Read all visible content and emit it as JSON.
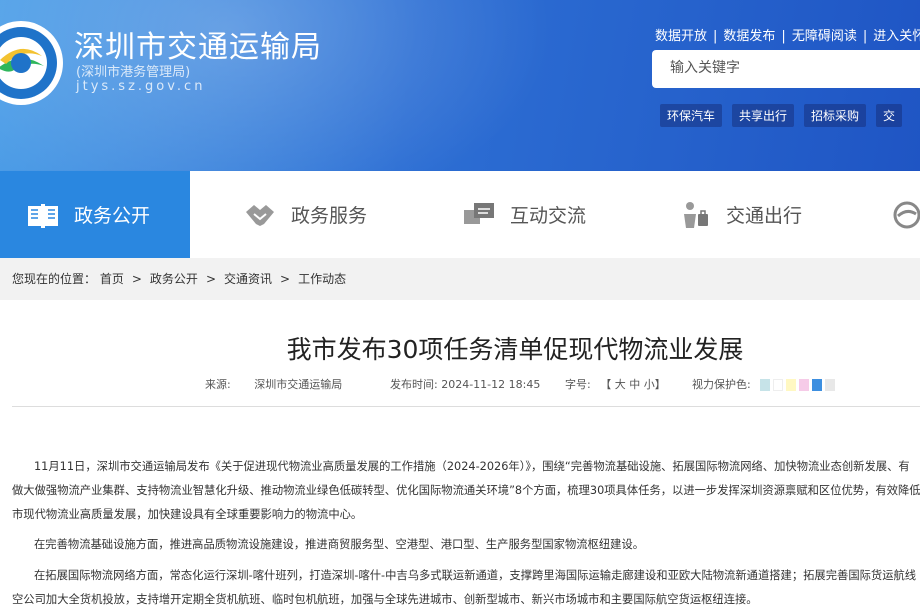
{
  "header": {
    "title": "深圳市交通运输局",
    "subtitle": "(深圳市港务管理局)",
    "url": "jtys.sz.gov.cn",
    "links": [
      "数据开放",
      "数据发布",
      "无障碍阅读",
      "进入关怀版"
    ],
    "search_placeholder": "输入关键字",
    "hot_tags": [
      "环保汽车",
      "共享出行",
      "招标采购",
      "交"
    ]
  },
  "nav": [
    {
      "label": "政务公开",
      "icon": "book-icon"
    },
    {
      "label": "政务服务",
      "icon": "handshake-icon"
    },
    {
      "label": "互动交流",
      "icon": "chat-icon"
    },
    {
      "label": "交通出行",
      "icon": "traveler-icon"
    },
    {
      "label": "",
      "icon": "circle-logo-icon"
    }
  ],
  "breadcrumb": {
    "prefix": "您现在的位置：",
    "items": [
      "首页",
      "政务公开",
      "交通资讯",
      "工作动态"
    ]
  },
  "article": {
    "title": "我市发布30项任务清单促现代物流业发展",
    "source_label": "来源:",
    "source": "深圳市交通运输局",
    "time_label": "发布时间:",
    "time": "2024-11-12 18:45",
    "font_label": "字号:",
    "font_options": "【 大 中 小】",
    "vision_label": "视力保护色:",
    "vision_colors": [
      "#c6e3e8",
      "#ffffff",
      "#fff8c2",
      "#f6cbe8",
      "#3d8fe0",
      "#e8e8e8"
    ],
    "paragraphs": [
      "11月11日，深圳市交通运输局发布《关于促进现代物流业高质量发展的工作措施（2024-2026年）》，围绕“完善物流基础设施、拓展国际物流网络、加快物流业态创新发展、有",
      "做大做强物流产业集群、支持物流业智慧化升级、推动物流业绿色低碳转型、优化国际物流通关环境”8个方面，梳理30项具体任务，以进一步发挥深圳资源禀赋和区位优势，有效降低",
      "市现代物流业高质量发展，加快建设具有全球重要影响力的物流中心。",
      "在完善物流基础设施方面，推进高品质物流设施建设，推进商贸服务型、空港型、港口型、生产服务型国家物流枢纽建设。",
      "在拓展国际物流网络方面，常态化运行深圳-喀什班列，打造深圳-喀什-中吉乌多式联运新通道，支撑跨里海国际运输走廊建设和亚欧大陆物流新通道搭建；拓展完善国际货运航线",
      "空公司加大全货机投放，支持增开定期全货机航班、临时包机航班，加强与全球先进城市、创新型城市、新兴市场城市和主要国际航空货运枢纽连接。"
    ]
  }
}
